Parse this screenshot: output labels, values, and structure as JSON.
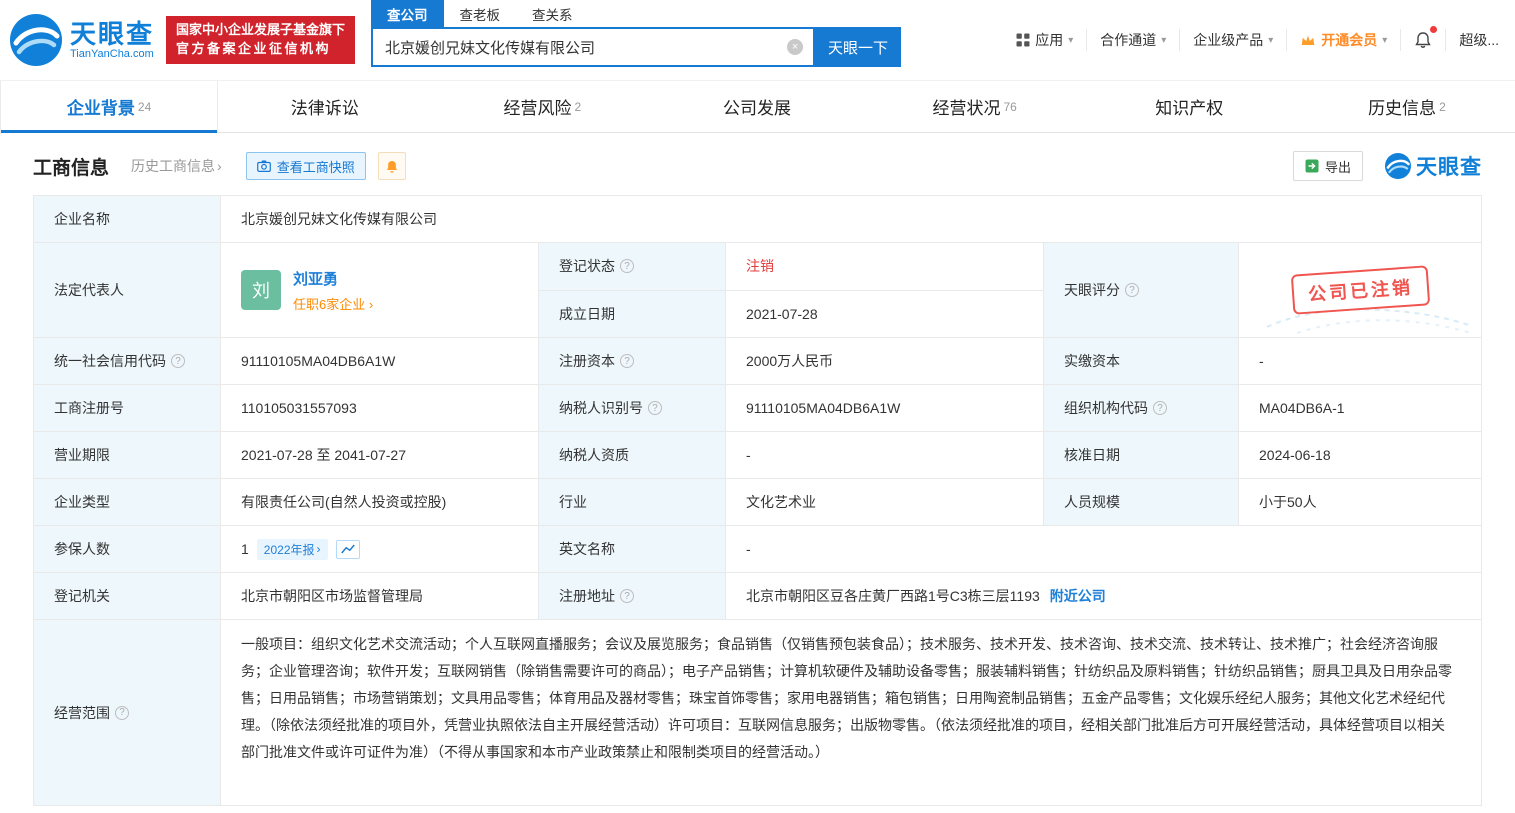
{
  "brand": {
    "name": "天眼查",
    "domain": "TianYanCha.com"
  },
  "icons": {
    "chevron_down": "▾",
    "chevron_right": "›",
    "clear": "×",
    "help": "?"
  },
  "header": {
    "badge_line1": "国家中小企业发展子基金旗下",
    "badge_line2": "官方备案企业征信机构",
    "search_tabs": [
      {
        "label": "查公司"
      },
      {
        "label": "查老板"
      },
      {
        "label": "查关系"
      }
    ],
    "search_value": "北京媛创兄妹文化传媒有限公司",
    "search_button": "天眼一下",
    "menu_apps": "应用",
    "menu_partner": "合作通道",
    "menu_enterprise": "企业级产品",
    "menu_vip": "开通会员",
    "user": "超级..."
  },
  "tabs": [
    {
      "label": "企业背景",
      "count": "24"
    },
    {
      "label": "法律诉讼",
      "count": ""
    },
    {
      "label": "经营风险",
      "count": "2"
    },
    {
      "label": "公司发展",
      "count": ""
    },
    {
      "label": "经营状况",
      "count": "76"
    },
    {
      "label": "知识产权",
      "count": ""
    },
    {
      "label": "历史信息",
      "count": "2"
    }
  ],
  "toolbar": {
    "title": "工商信息",
    "history_link": "历史工商信息",
    "snapshot_button": "查看工商快照",
    "export_button": "导出"
  },
  "stamp_text": "公司已注销",
  "fields": {
    "company_name": {
      "label": "企业名称",
      "value": "北京媛创兄妹文化传媒有限公司"
    },
    "legal_rep": {
      "label": "法定代表人",
      "avatar": "刘",
      "name": "刘亚勇",
      "link": "任职6家企业"
    },
    "reg_status": {
      "label": "登记状态",
      "value": "注销"
    },
    "establish_date": {
      "label": "成立日期",
      "value": "2021-07-28"
    },
    "tianyan_score": {
      "label": "天眼评分"
    },
    "credit_code": {
      "label": "统一社会信用代码",
      "value": "91110105MA04DB6A1W"
    },
    "reg_capital": {
      "label": "注册资本",
      "value": "2000万人民币"
    },
    "paid_capital": {
      "label": "实缴资本",
      "value": "-"
    },
    "reg_number": {
      "label": "工商注册号",
      "value": "110105031557093"
    },
    "taxpayer_id": {
      "label": "纳税人识别号",
      "value": "91110105MA04DB6A1W"
    },
    "org_code": {
      "label": "组织机构代码",
      "value": "MA04DB6A-1"
    },
    "business_term": {
      "label": "营业期限",
      "value": "2021-07-28 至 2041-07-27"
    },
    "taxpayer_qualification": {
      "label": "纳税人资质",
      "value": "-"
    },
    "approval_date": {
      "label": "核准日期",
      "value": "2024-06-18"
    },
    "company_type": {
      "label": "企业类型",
      "value": "有限责任公司(自然人投资或控股)"
    },
    "industry": {
      "label": "行业",
      "value": "文化艺术业"
    },
    "staff_size": {
      "label": "人员规模",
      "value": "小于50人"
    },
    "insured_count": {
      "label": "参保人数",
      "value": "1",
      "tag": "2022年报"
    },
    "english_name": {
      "label": "英文名称",
      "value": "-"
    },
    "reg_authority": {
      "label": "登记机关",
      "value": "北京市朝阳区市场监督管理局"
    },
    "reg_address": {
      "label": "注册地址",
      "value": "北京市朝阳区豆各庄黄厂西路1号C3栋三层1193",
      "link": "附近公司"
    },
    "business_scope": {
      "label": "经营范围",
      "value": "一般项目：组织文化艺术交流活动；个人互联网直播服务；会议及展览服务；食品销售（仅销售预包装食品）；技术服务、技术开发、技术咨询、技术交流、技术转让、技术推广；社会经济咨询服务；企业管理咨询；软件开发；互联网销售（除销售需要许可的商品）；电子产品销售；计算机软硬件及辅助设备零售；服装辅料销售；针纺织品及原料销售；针纺织品销售；厨具卫具及日用杂品零售；日用品销售；市场营销策划；文具用品零售；体育用品及器材零售；珠宝首饰零售；家用电器销售；箱包销售；日用陶瓷制品销售；五金产品零售；文化娱乐经纪人服务；其他文化艺术经纪代理。（除依法须经批准的项目外，凭营业执照依法自主开展经营活动）许可项目：互联网信息服务；出版物零售。（依法须经批准的项目，经相关部门批准后方可开展经营活动，具体经营项目以相关部门批准文件或许可证件为准）（不得从事国家和本市产业政策禁止和限制类项目的经营活动。）"
    }
  }
}
